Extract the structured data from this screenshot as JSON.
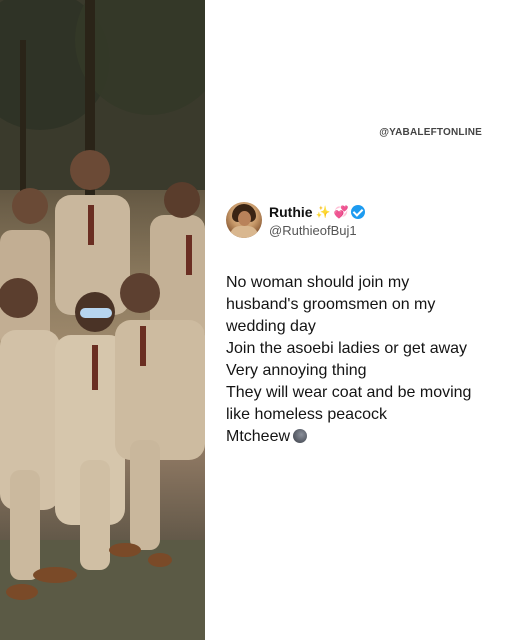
{
  "watermark": "@YABALEFTONLINE",
  "tweet": {
    "display_name": "Ruthie",
    "handle": "@RuthieofBuj1",
    "lines": [
      "No woman should join my",
      "husband's groomsmen on my",
      "wedding day",
      "Join the asoebi ladies or get away",
      "Very annoying thing",
      "They will wear coat and be moving",
      "like homeless peacock",
      "Mtcheew"
    ],
    "name_emojis": [
      "sparkles-icon",
      "heart-icon"
    ],
    "end_emoji": "new-moon-face-icon"
  },
  "colors": {
    "verified_badge": "#1d9bf0",
    "text": "#141414",
    "handle": "#555555"
  }
}
